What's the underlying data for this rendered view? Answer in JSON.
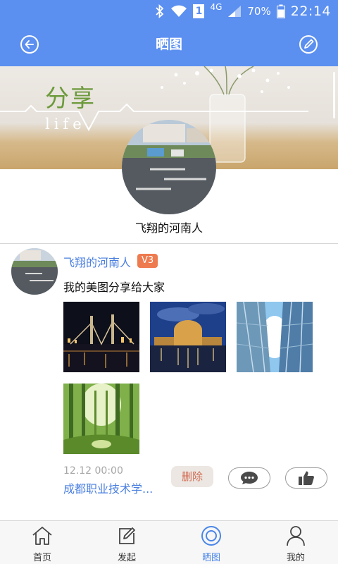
{
  "status_bar": {
    "battery_percent": "70%",
    "time": "22:14",
    "network": "4G",
    "sim_indicator": "1"
  },
  "header": {
    "title": "晒图",
    "back_icon": "back-circle-icon",
    "edit_icon": "edit-circle-icon"
  },
  "banner": {
    "text": "分享",
    "subtext": "life"
  },
  "profile": {
    "name": "飞翔的河南人"
  },
  "post": {
    "author": "飞翔的河南人",
    "level": "V3",
    "text": "我的美图分享给大家",
    "images": [
      "night-bridge-photo",
      "palace-night-photo",
      "skyscrapers-photo",
      "forest-photo"
    ],
    "time": "12.12 00:00",
    "school": "成都职业技术学...",
    "delete_label": "删除",
    "comment_icon": "comment-bubble-icon",
    "like_icon": "thumbs-up-icon"
  },
  "bottom_nav": [
    {
      "label": "首页",
      "icon": "home-icon"
    },
    {
      "label": "发起",
      "icon": "compose-icon"
    },
    {
      "label": "晒图",
      "icon": "photo-share-icon",
      "active": true
    },
    {
      "label": "我的",
      "icon": "user-icon"
    }
  ],
  "colors": {
    "primary": "#5b8ff0",
    "link": "#4a7fe0",
    "badge": "#ee7a4f",
    "delete_text": "#d16b54"
  }
}
